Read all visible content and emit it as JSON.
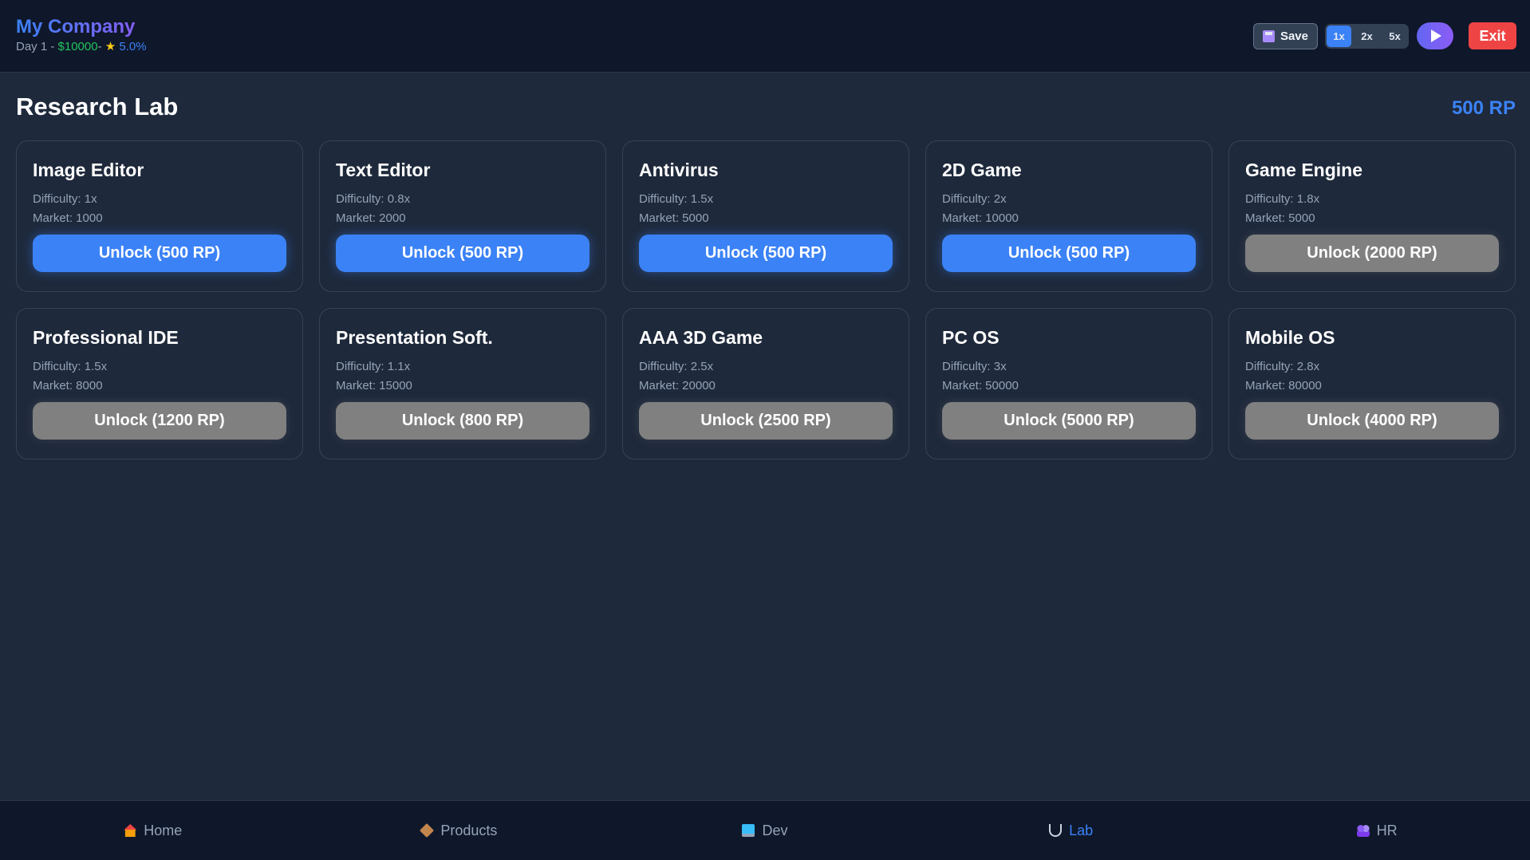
{
  "header": {
    "company_name": "My Company",
    "day": "Day 1 - ",
    "money": "$10000",
    "separator": "- ",
    "reputation": "5.0%",
    "save_label": "Save",
    "speeds": [
      "1x",
      "2x",
      "5x"
    ],
    "active_speed": "1x",
    "exit_label": "Exit"
  },
  "page": {
    "title": "Research Lab",
    "rp_total": "500 RP"
  },
  "cards": [
    {
      "name": "Image Editor",
      "difficulty": "Difficulty: 1x",
      "market": "Market: 1000",
      "button": "Unlock (500 RP)",
      "affordable": true
    },
    {
      "name": "Text Editor",
      "difficulty": "Difficulty: 0.8x",
      "market": "Market: 2000",
      "button": "Unlock (500 RP)",
      "affordable": true
    },
    {
      "name": "Antivirus",
      "difficulty": "Difficulty: 1.5x",
      "market": "Market: 5000",
      "button": "Unlock (500 RP)",
      "affordable": true
    },
    {
      "name": "2D Game",
      "difficulty": "Difficulty: 2x",
      "market": "Market: 10000",
      "button": "Unlock (500 RP)",
      "affordable": true
    },
    {
      "name": "Game Engine",
      "difficulty": "Difficulty: 1.8x",
      "market": "Market: 5000",
      "button": "Unlock (2000 RP)",
      "affordable": false
    },
    {
      "name": "Professional IDE",
      "difficulty": "Difficulty: 1.5x",
      "market": "Market: 8000",
      "button": "Unlock (1200 RP)",
      "affordable": false
    },
    {
      "name": "Presentation Soft.",
      "difficulty": "Difficulty: 1.1x",
      "market": "Market: 15000",
      "button": "Unlock (800 RP)",
      "affordable": false
    },
    {
      "name": "AAA 3D Game",
      "difficulty": "Difficulty: 2.5x",
      "market": "Market: 20000",
      "button": "Unlock (2500 RP)",
      "affordable": false
    },
    {
      "name": "PC OS",
      "difficulty": "Difficulty: 3x",
      "market": "Market: 50000",
      "button": "Unlock (5000 RP)",
      "affordable": false
    },
    {
      "name": "Mobile OS",
      "difficulty": "Difficulty: 2.8x",
      "market": "Market: 80000",
      "button": "Unlock (4000 RP)",
      "affordable": false
    }
  ],
  "nav": [
    {
      "label": "Home",
      "icon": "home-icon"
    },
    {
      "label": "Products",
      "icon": "package-icon"
    },
    {
      "label": "Dev",
      "icon": "laptop-icon"
    },
    {
      "label": "Lab",
      "icon": "microscope-icon",
      "active": true
    },
    {
      "label": "HR",
      "icon": "people-icon"
    }
  ],
  "colors": {
    "accent": "#3b82f6",
    "background": "#1e293b",
    "header": "#0f172a",
    "money": "#22c55e",
    "danger": "#ef4444",
    "locked": "#808080"
  }
}
